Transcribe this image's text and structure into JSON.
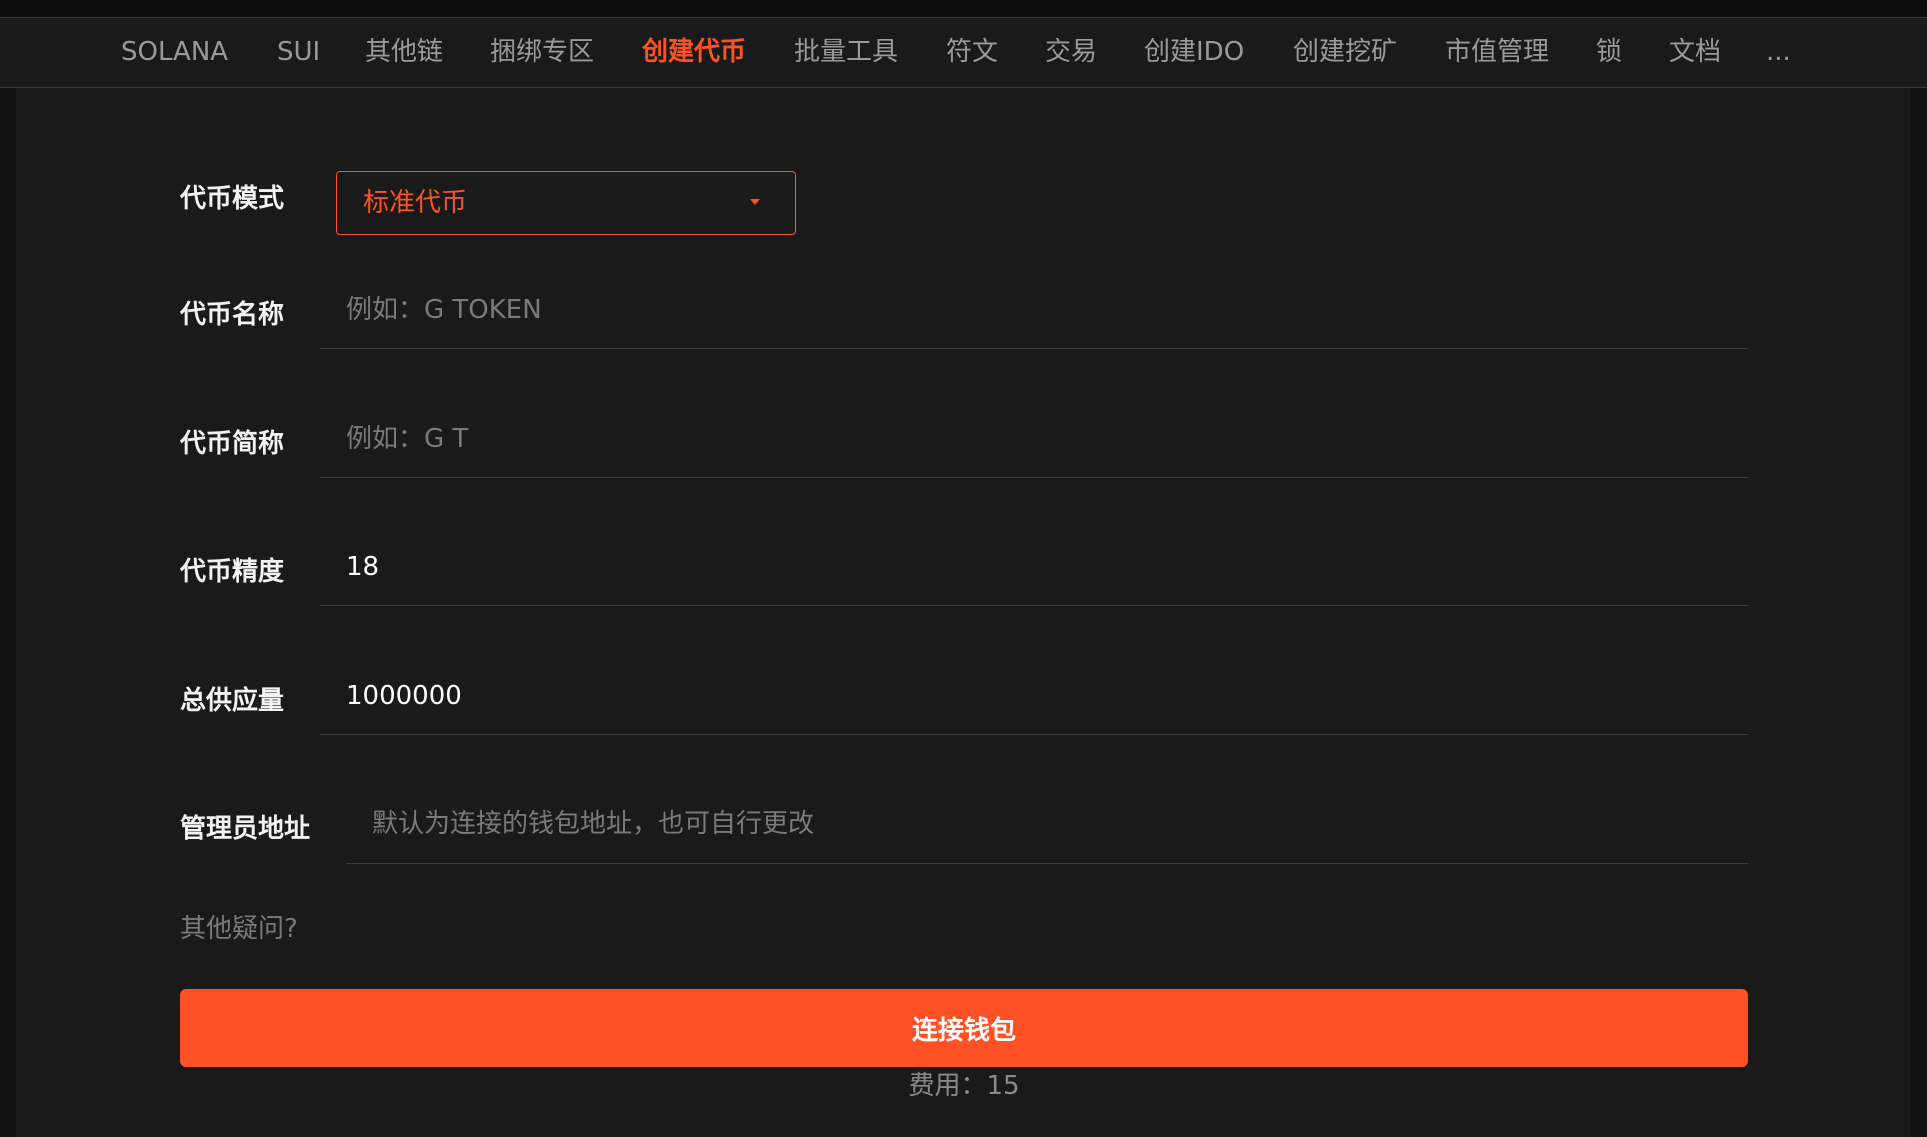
{
  "nav": {
    "items": [
      "SOLANA",
      "SUI",
      "其他链",
      "捆绑专区",
      "创建代币",
      "批量工具",
      "符文",
      "交易",
      "创建IDO",
      "创建挖矿",
      "市值管理",
      "锁",
      "文档",
      "..."
    ],
    "active": "创建代币"
  },
  "form": {
    "mode": {
      "label": "代币模式",
      "value": "标准代币"
    },
    "name": {
      "label": "代币名称",
      "placeholder": "例如：G TOKEN",
      "value": ""
    },
    "symbol": {
      "label": "代币简称",
      "placeholder": "例如：G T",
      "value": ""
    },
    "decimals": {
      "label": "代币精度",
      "value": "18"
    },
    "supply": {
      "label": "总供应量",
      "value": "1000000"
    },
    "admin": {
      "label": "管理员地址",
      "placeholder": "默认为连接的钱包地址，也可自行更改",
      "value": ""
    }
  },
  "help_link": "其他疑问?",
  "connect_button": "连接钱包",
  "fee": "费用：15",
  "colors": {
    "accent": "#ff5126",
    "background": "#1a1a1a"
  }
}
